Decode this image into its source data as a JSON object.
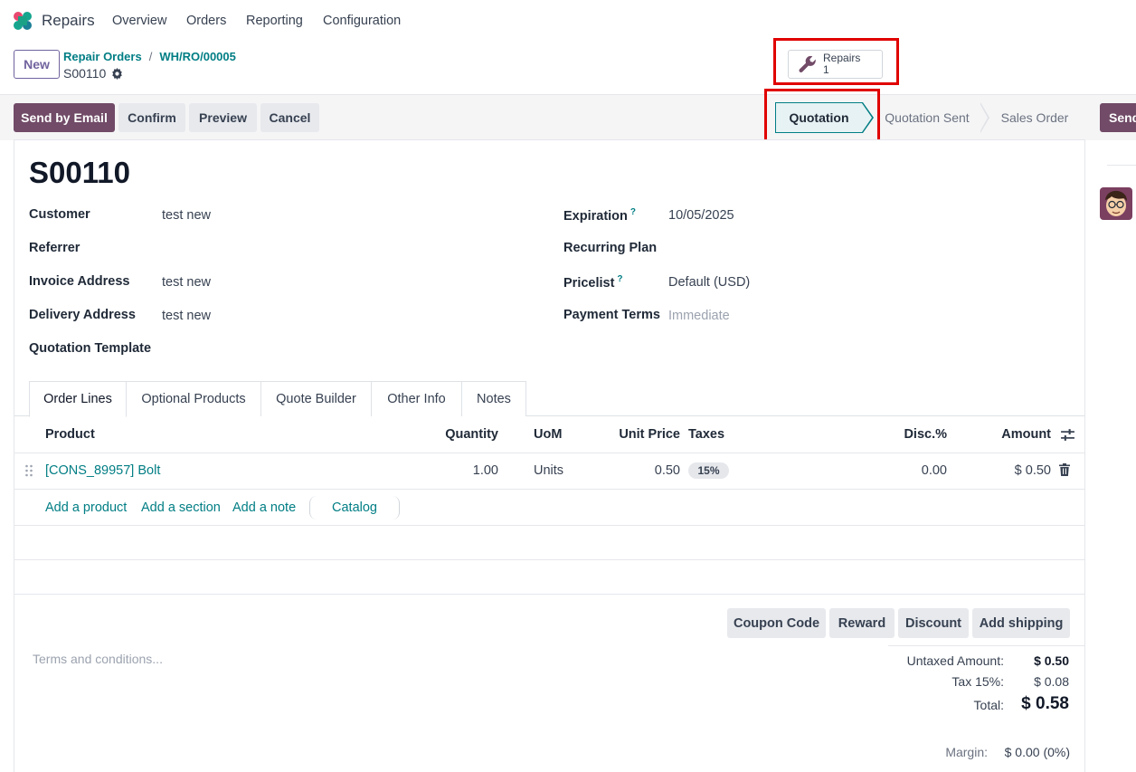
{
  "app": {
    "name": "Repairs",
    "menu": [
      "Overview",
      "Orders",
      "Reporting",
      "Configuration"
    ]
  },
  "control_panel": {
    "new_label": "New",
    "breadcrumb": [
      "Repair Orders",
      "WH/RO/00005"
    ],
    "breadcrumb_sep": "/",
    "record_name": "S00110"
  },
  "smart_button": {
    "label": "Repairs",
    "count": "1",
    "icon": "wrench-icon"
  },
  "actions": [
    "Send by Email",
    "Confirm",
    "Preview",
    "Cancel"
  ],
  "stages": [
    "Quotation",
    "Quotation Sent",
    "Sales Order"
  ],
  "stage_overflow_label": "Send",
  "form": {
    "title": "S00110",
    "left": [
      {
        "label": "Customer",
        "value": "test new"
      },
      {
        "label": "Referrer",
        "value": ""
      },
      {
        "label": "Invoice Address",
        "value": "test new"
      },
      {
        "label": "Delivery Address",
        "value": "test new"
      },
      {
        "label": "Quotation Template",
        "value": ""
      }
    ],
    "right": [
      {
        "label": "Expiration",
        "help": "?",
        "value": "10/05/2025"
      },
      {
        "label": "Recurring Plan",
        "value": ""
      },
      {
        "label": "Pricelist",
        "help": "?",
        "value": "Default (USD)"
      },
      {
        "label": "Payment Terms",
        "value": "Immediate"
      }
    ]
  },
  "tabs": [
    "Order Lines",
    "Optional Products",
    "Quote Builder",
    "Other Info",
    "Notes"
  ],
  "order_lines": {
    "columns": [
      "Product",
      "Quantity",
      "UoM",
      "Unit Price",
      "Taxes",
      "Disc.%",
      "Amount"
    ],
    "rows": [
      {
        "product": "[CONS_89957] Bolt",
        "quantity": "1.00",
        "uom": "Units",
        "unit_price": "0.50",
        "taxes": "15%",
        "discount": "0.00",
        "amount": "$ 0.50"
      }
    ],
    "add_links": [
      "Add a product",
      "Add a section",
      "Add a note"
    ],
    "catalog_label": "Catalog"
  },
  "footer_buttons": [
    "Coupon Code",
    "Reward",
    "Discount",
    "Add shipping"
  ],
  "terms_placeholder": "Terms and conditions...",
  "totals": {
    "untaxed_label": "Untaxed Amount:",
    "untaxed_value": "$ 0.50",
    "tax_label": "Tax 15%:",
    "tax_value": "$ 0.08",
    "total_label": "Total:",
    "total_value": "$ 0.58",
    "margin_label": "Margin:",
    "margin_value": "$ 0.00 (0%)"
  },
  "colors": {
    "brand": "#714b67",
    "link": "#017e84",
    "highlight": "#e00000"
  }
}
